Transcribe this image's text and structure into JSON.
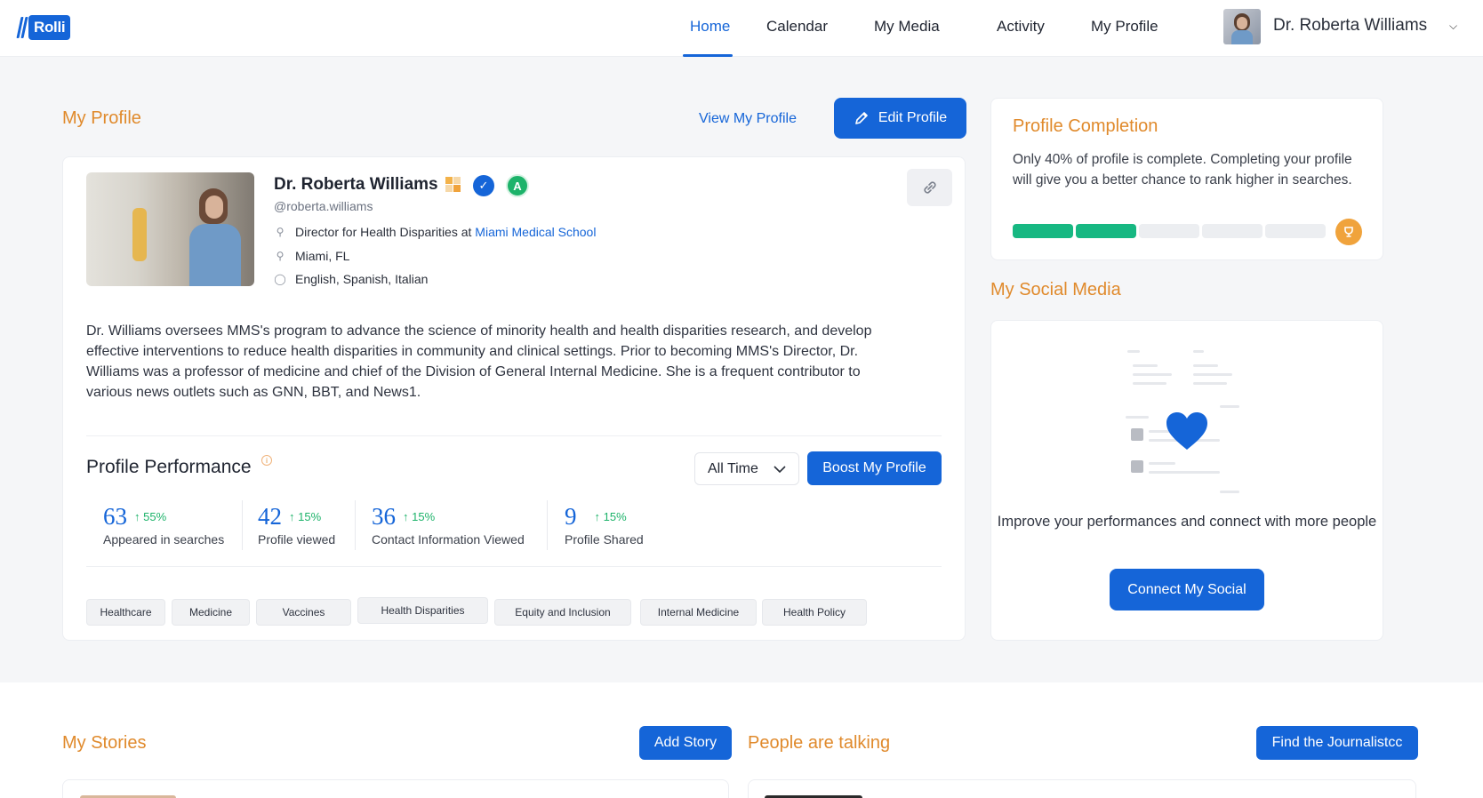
{
  "nav": {
    "logo": "Rolli",
    "items": [
      "Home",
      "Calendar",
      "My Media",
      "Activity",
      "My Profile"
    ],
    "user_name": "Dr. Roberta Williams"
  },
  "profile_section": {
    "title": "My Profile",
    "view_label": "View  My Profile",
    "edit_label": "Edit Profile"
  },
  "profile": {
    "name": "Dr. Roberta Williams",
    "handle": "@roberta.williams",
    "role_prefix": "Director for Health Disparities at",
    "organization": "Miami Medical School",
    "location": "Miami, FL",
    "languages": "English, Spanish, Italian",
    "bio": "Dr. Williams oversees MMS's program to advance the science of minority health and health disparities research, and develop effective interventions to reduce health disparities in community and clinical settings. Prior to becoming MMS's Director, Dr. Williams was a professor of medicine and chief of the Division of General Internal Medicine. She is a frequent contributor to various news outlets such as GNN, BBT, and News1."
  },
  "performance": {
    "title": "Profile Performance",
    "period": "All Time",
    "boost_label": "Boost My Profile",
    "stats": [
      {
        "value": "63",
        "delta": "55%",
        "label": "Appeared in searches"
      },
      {
        "value": "42",
        "delta": "15%",
        "label": "Profile viewed"
      },
      {
        "value": "36",
        "delta": "15%",
        "label": "Contact Information Viewed"
      },
      {
        "value": "9",
        "delta": "15%",
        "label": "Profile Shared"
      }
    ]
  },
  "tags": [
    "Healthcare",
    "Medicine",
    "Vaccines",
    "Health Disparities",
    "Equity and Inclusion",
    "Internal Medicine",
    "Health Policy"
  ],
  "completion": {
    "title": "Profile Completion",
    "text": "Only 40% of profile is complete. Completing your profile will give you a better chance to rank higher in searches.",
    "percent": 40,
    "segments_total": 5,
    "segments_done": 2
  },
  "social": {
    "title": "My Social Media",
    "text": "Improve your performances and connect with more people",
    "button": "Connect My Social"
  },
  "stories": {
    "title": "My Stories",
    "button": "Add Story"
  },
  "talking": {
    "title": "People are talking",
    "button": "Find the Journalistcc"
  },
  "colors": {
    "accent": "#1565d8",
    "orange": "#e08a2c",
    "green": "#1db36a",
    "progress_done": "#17b882",
    "progress_empty": "#eceef1"
  }
}
